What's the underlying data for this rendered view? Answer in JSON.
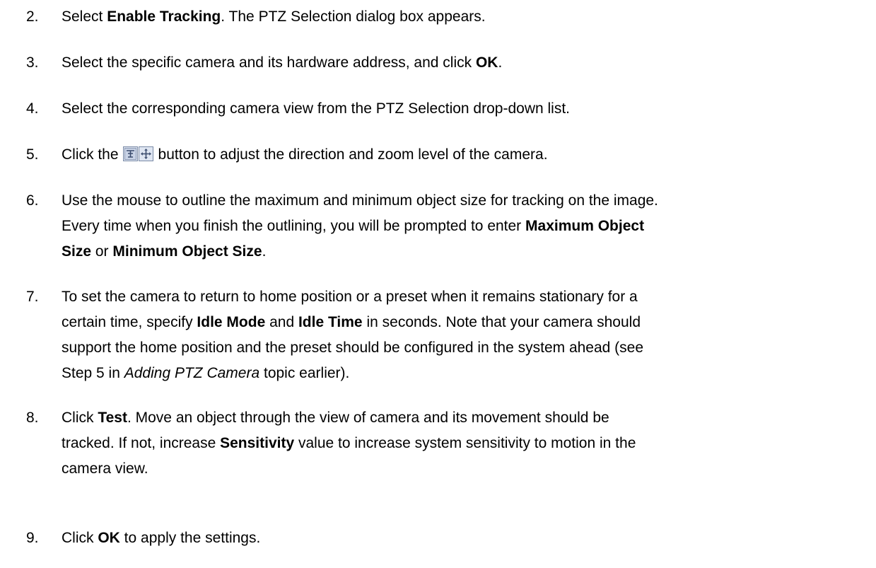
{
  "steps": [
    {
      "number": "2.",
      "t1": "Select ",
      "b1": "Enable Tracking",
      "t2": ". The PTZ Selection dialog box appears."
    },
    {
      "number": "3.",
      "t1": "Select the specific camera and its hardware address, and click ",
      "b1": "OK",
      "t2": "."
    },
    {
      "number": "4.",
      "t1": "Select the corresponding camera view from the PTZ Selection drop-down list."
    },
    {
      "number": "5.",
      "t1": "Click the",
      "icon": "ptz-control-icon",
      "t2": "button to adjust the direction and zoom level of the camera."
    },
    {
      "number": "6.",
      "l1": "Use the mouse to outline the maximum and minimum object size for tracking on the image.",
      "l2a": "Every time when you finish the outlining, you will be prompted to enter ",
      "l2b": "Maximum Object",
      "l3a": "Size",
      "l3b": " or ",
      "l3c": "Minimum Object Size",
      "l3d": "."
    },
    {
      "number": "7.",
      "l1": "To set the camera to return to home position or a preset when it remains stationary for a",
      "l2a": "certain time, specify ",
      "l2b": "Idle Mode",
      "l2c": " and ",
      "l2d": "Idle Time",
      "l2e": " in seconds. Note that your camera should",
      "l3": "support the home position and the preset should be configured in the system ahead (see",
      "l4a": "Step 5 in ",
      "l4b": "Adding PTZ Camera",
      "l4c": " topic earlier)."
    },
    {
      "number": "8.",
      "l1a": "Click ",
      "l1b": "Test",
      "l1c": ". Move an object through the view of camera and its movement should be",
      "l2a": "tracked. If not, increase ",
      "l2b": "Sensitivity",
      "l2c": " value to increase system sensitivity to motion in the",
      "l3": "camera view."
    },
    {
      "number": "9.",
      "t1": "Click ",
      "b1": "OK",
      "t2": " to apply the settings."
    }
  ],
  "colors": {
    "text": "#000000",
    "background": "#ffffff",
    "icon_border": "#7a8aa6",
    "icon_fill": "#dfe6f2"
  }
}
